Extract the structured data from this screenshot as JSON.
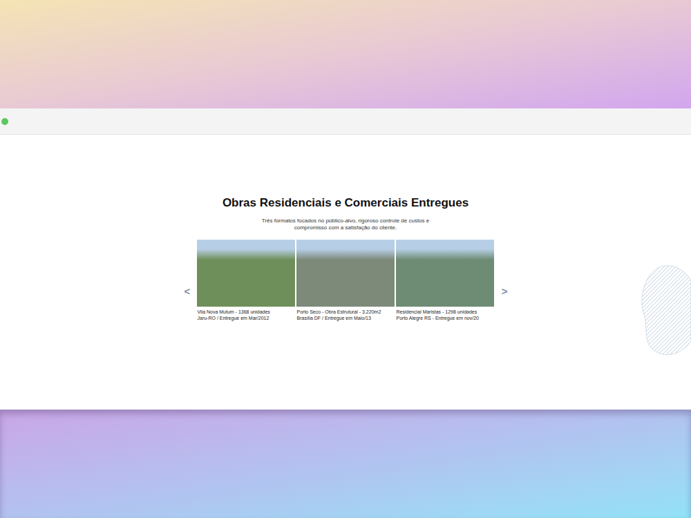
{
  "window": {
    "status_dot_color": "#5cc85a"
  },
  "section": {
    "title": "Obras Residenciais e Comerciais Entregues",
    "subtitle": [
      "Três formatos focados no público-alvo, rigoroso controle de custos e",
      "compromisso com a satisfação do cliente."
    ]
  },
  "carousel": {
    "prev": "<",
    "next": ">",
    "projects": [
      {
        "caption": [
          "Vila Nova Mutum - 1368 unidades",
          "Jaru-RO / Entregue em Mar/2012"
        ],
        "color": "#6f8f5a"
      },
      {
        "caption": [
          "Porto Seco - Obra Estrutural - 3.220m2",
          "Brasília DF / Entregue em Maio/13"
        ],
        "color": "#7d8a7a"
      },
      {
        "caption": [
          "Residencial Maristas - 1298 unidades",
          "Porto Alegre RS - Entregue em nov/20"
        ],
        "color": "#6e8c74"
      }
    ]
  }
}
